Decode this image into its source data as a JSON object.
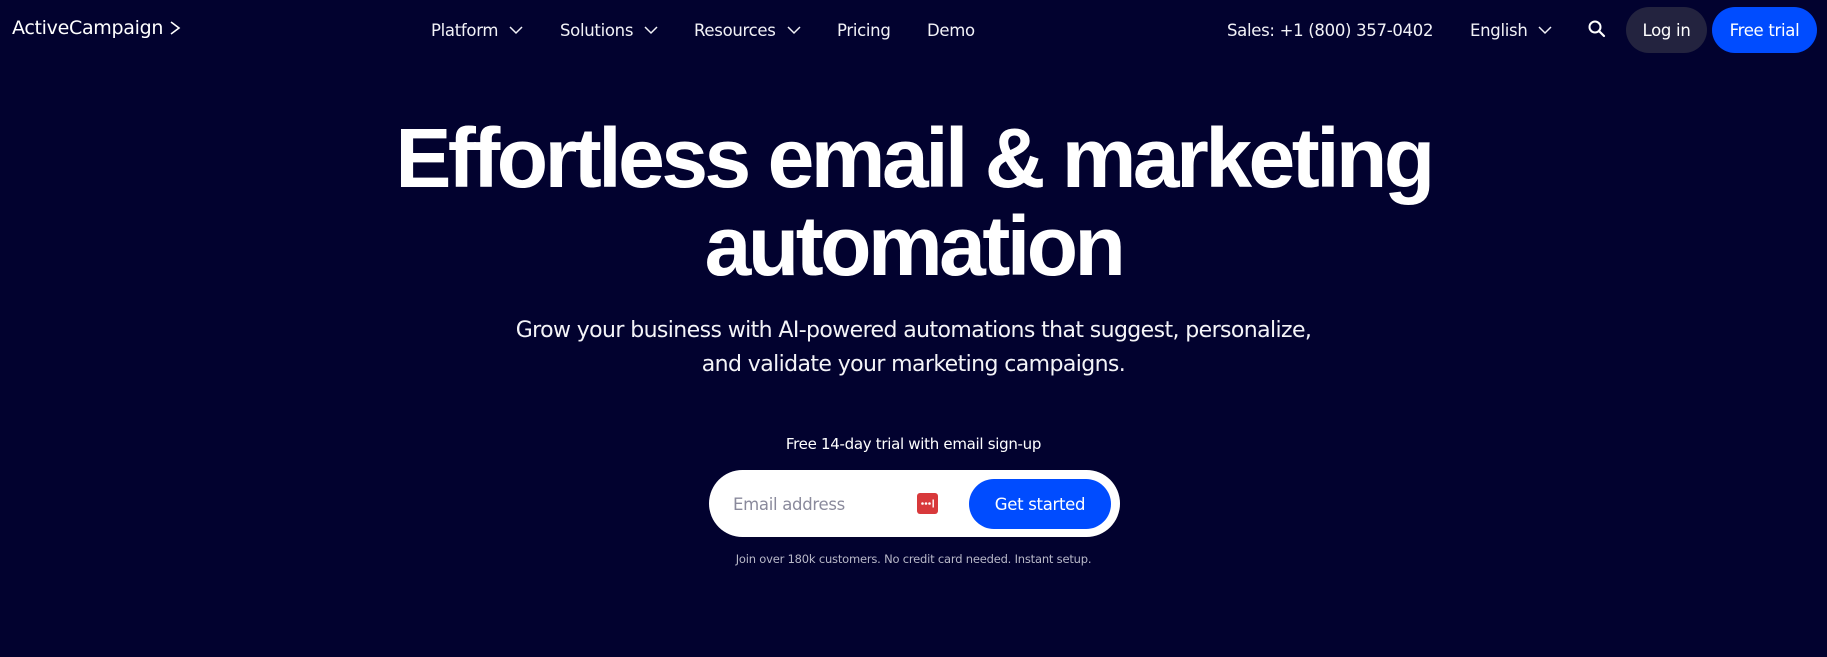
{
  "header": {
    "logo_text": "ActiveCampaign",
    "logo_mark": "chevron-right-logo",
    "nav": [
      {
        "label": "Platform",
        "has_dropdown": true
      },
      {
        "label": "Solutions",
        "has_dropdown": true
      },
      {
        "label": "Resources",
        "has_dropdown": true
      },
      {
        "label": "Pricing",
        "has_dropdown": false
      },
      {
        "label": "Demo",
        "has_dropdown": false
      }
    ],
    "sales_phone": "Sales: +1 (800) 357-0402",
    "language": "English",
    "search_icon": "search-icon",
    "login_label": "Log in",
    "free_trial_label": "Free trial"
  },
  "hero": {
    "headline_line1": "Effortless email & marketing",
    "headline_line2": "automation",
    "subhead_line1": "Grow your business with AI-powered automations that suggest, personalize,",
    "subhead_line2": "and validate your marketing campaigns.",
    "trial_label": "Free 14-day trial with email sign-up",
    "email_placeholder": "Email address",
    "email_value": "",
    "cta_label": "Get started",
    "fineprint": "Join over 180k customers. No credit card needed. Instant setup."
  },
  "colors": {
    "background": "#02022f",
    "primary_blue": "#004cff",
    "login_bg": "#23233f",
    "password_manager_icon": "#d8393b"
  }
}
